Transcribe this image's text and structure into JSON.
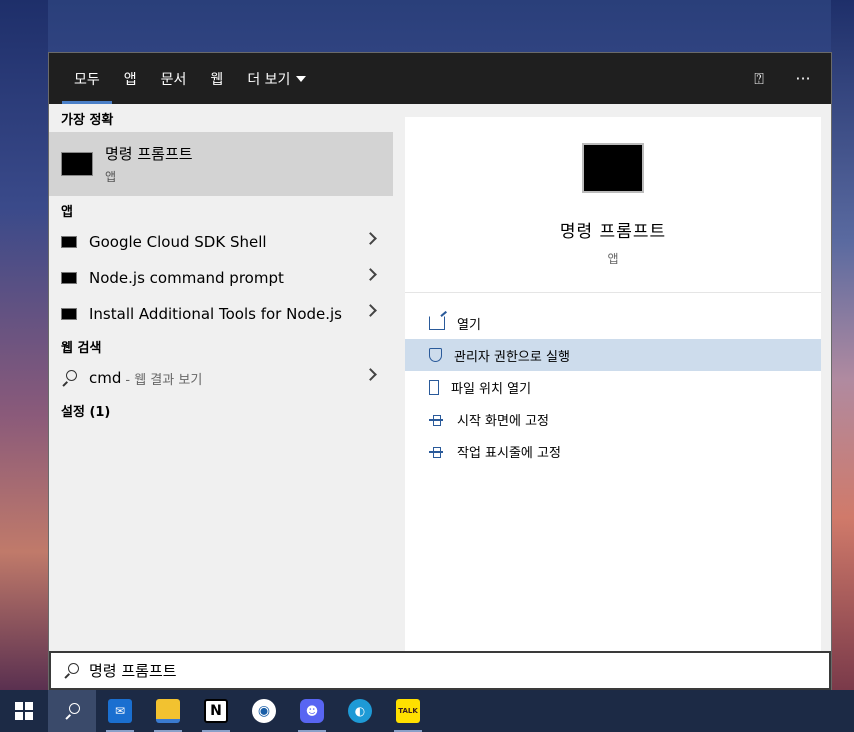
{
  "tabs": [
    {
      "label": "모두"
    },
    {
      "label": "앱"
    },
    {
      "label": "문서"
    },
    {
      "label": "웹"
    },
    {
      "label": "더 보기"
    }
  ],
  "best_match": {
    "header": "가장 정확",
    "title": "명령 프롬프트",
    "subtitle": "앱"
  },
  "apps": {
    "header": "앱",
    "items": [
      {
        "label": "Google Cloud SDK Shell"
      },
      {
        "label": "Node.js command prompt"
      },
      {
        "label": "Install Additional Tools for Node.js"
      }
    ]
  },
  "web": {
    "header": "웹 검색",
    "query": "cmd",
    "suffix": "- 웹 결과 보기"
  },
  "settings": {
    "header": "설정 (1)"
  },
  "preview": {
    "title": "명령 프롬프트",
    "subtitle": "앱"
  },
  "actions": [
    {
      "label": "열기",
      "icon": "open-icon"
    },
    {
      "label": "관리자 권한으로 실행",
      "icon": "shield-icon"
    },
    {
      "label": "파일 위치 열기",
      "icon": "folder-icon"
    },
    {
      "label": "시작 화면에 고정",
      "icon": "pin-icon"
    },
    {
      "label": "작업 표시줄에 고정",
      "icon": "pin-icon"
    }
  ],
  "search": {
    "value": "명령 프롬프트"
  },
  "taskbar": {
    "notion": "N",
    "talk": "TALK"
  }
}
